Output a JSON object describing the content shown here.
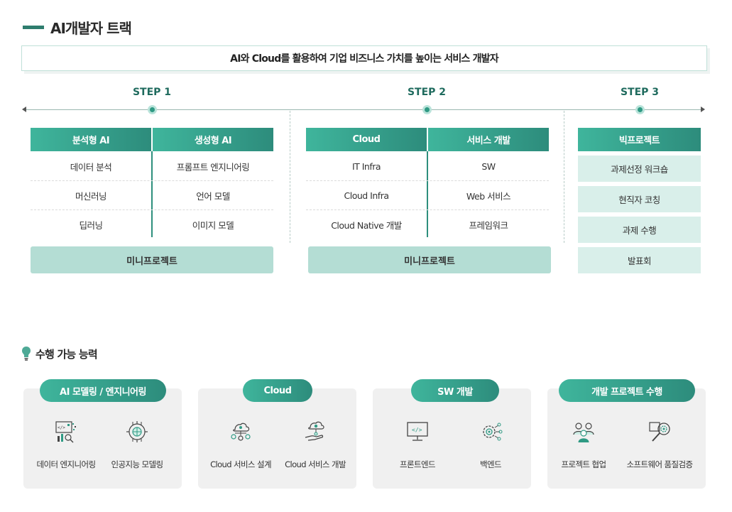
{
  "title": "AI개발자 트랙",
  "subtitle": "AI와 Cloud를 활용하여 기업 비즈니스 가치를 높이는 서비스 개발자",
  "steps": [
    {
      "label": "STEP 1"
    },
    {
      "label": "STEP 2"
    },
    {
      "label": "STEP 3"
    }
  ],
  "step1": {
    "columns": [
      {
        "header": "분석형 AI",
        "items": [
          "데이터 분석",
          "머신러닝",
          "딥러닝"
        ]
      },
      {
        "header": "생성형 AI",
        "items": [
          "프롬프트 엔지니어링",
          "언어 모델",
          "이미지 모델"
        ]
      }
    ],
    "mini_project": "미니프로젝트"
  },
  "step2": {
    "columns": [
      {
        "header": "Cloud",
        "items": [
          "IT Infra",
          "Cloud Infra",
          "Cloud Native 개발"
        ]
      },
      {
        "header": "서비스 개발",
        "items": [
          "SW",
          "Web 서비스",
          "프레임워크"
        ]
      }
    ],
    "mini_project": "미니프로젝트"
  },
  "step3": {
    "header": "빅프로젝트",
    "items": [
      "과제선정 워크숍",
      "현직자 코칭",
      "과제 수행",
      "발표회"
    ]
  },
  "capabilities": {
    "title": "수행 가능 능력",
    "icon": "lightbulb-icon",
    "cards": [
      {
        "title": "AI 모델링 / 엔지니어링",
        "items": [
          {
            "label": "데이터 엔지니어링",
            "icon": "data-engineering-icon"
          },
          {
            "label": "인공지능 모델링",
            "icon": "ai-chip-icon"
          }
        ]
      },
      {
        "title": "Cloud",
        "items": [
          {
            "label": "Cloud 서비스 설계",
            "icon": "cloud-design-icon"
          },
          {
            "label": "Cloud 서비스 개발",
            "icon": "cloud-dev-icon"
          }
        ]
      },
      {
        "title": "SW 개발",
        "items": [
          {
            "label": "프론트엔드",
            "icon": "monitor-code-icon"
          },
          {
            "label": "백엔드",
            "icon": "gear-network-icon"
          }
        ]
      },
      {
        "title": "개발 프로젝트 수행",
        "items": [
          {
            "label": "프로젝트 협업",
            "icon": "team-icon"
          },
          {
            "label": "소프트웨어 품질검증",
            "icon": "quality-search-icon"
          }
        ]
      }
    ]
  },
  "colors": {
    "accent": "#2e8f7d",
    "accent_light": "#3fb59c",
    "pale": "#d9efea",
    "mini": "#b4ddd4"
  }
}
